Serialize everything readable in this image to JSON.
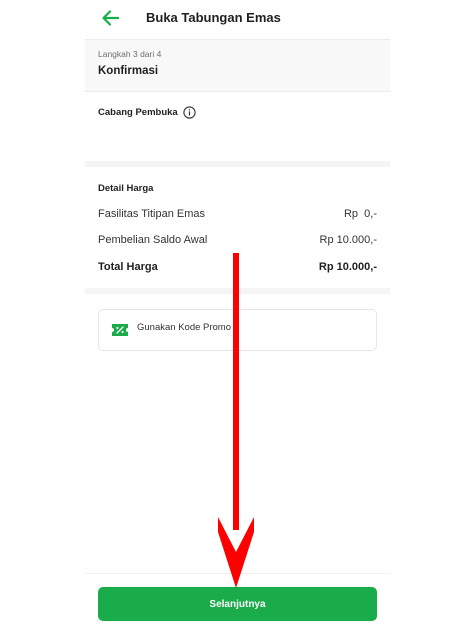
{
  "header": {
    "title": "Buka Tabungan Emas",
    "back_icon": "arrow-left-icon"
  },
  "step": {
    "label": "Langkah 3 dari 4",
    "title": "Konfirmasi"
  },
  "branch": {
    "label": "Cabang Pembuka",
    "info_icon": "info-icon"
  },
  "price_detail": {
    "title": "Detail Harga",
    "rows": [
      {
        "label": "Fasilitas Titipan Emas",
        "value": "Rp  0,-"
      },
      {
        "label": "Pembelian Saldo Awal",
        "value": "Rp 10.000,-"
      }
    ],
    "total": {
      "label": "Total Harga",
      "value": "Rp 10.000,-"
    }
  },
  "promo": {
    "label": "Gunakan Kode Promo",
    "icon": "ticket-percent-icon"
  },
  "footer": {
    "next_label": "Selanjutnya"
  },
  "colors": {
    "primary_green": "#1aab4b",
    "annotation_red": "#ff0000"
  }
}
